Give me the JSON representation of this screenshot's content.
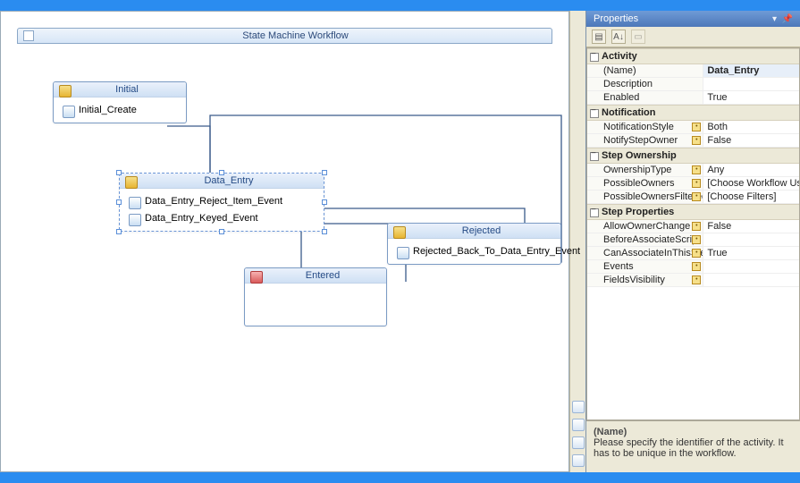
{
  "workflow": {
    "title": "State Machine Workflow",
    "nodes": {
      "initial": {
        "label": "Initial",
        "events": [
          "Initial_Create"
        ]
      },
      "data_entry": {
        "label": "Data_Entry",
        "events": [
          "Data_Entry_Reject_Item_Event",
          "Data_Entry_Keyed_Event"
        ]
      },
      "rejected": {
        "label": "Rejected",
        "events": [
          "Rejected_Back_To_Data_Entry_Event"
        ]
      },
      "entered": {
        "label": "Entered",
        "events": []
      }
    }
  },
  "properties_panel": {
    "title": "Properties",
    "categories": [
      {
        "name": "Activity",
        "props": [
          {
            "k": "(Name)",
            "v": "Data_Entry",
            "selected": true
          },
          {
            "k": "Description",
            "v": ""
          },
          {
            "k": "Enabled",
            "v": "True"
          }
        ]
      },
      {
        "name": "Notification",
        "props": [
          {
            "k": "NotificationStyle",
            "v": "Both",
            "enum": true
          },
          {
            "k": "NotifyStepOwner",
            "v": "False",
            "enum": true
          }
        ]
      },
      {
        "name": "Step Ownership",
        "props": [
          {
            "k": "OwnershipType",
            "v": "Any",
            "enum": true
          },
          {
            "k": "PossibleOwners",
            "v": "[Choose Workflow Users]",
            "enum": true
          },
          {
            "k": "PossibleOwnersFilteredBy",
            "v": "[Choose Filters]",
            "enum": true
          }
        ]
      },
      {
        "name": "Step Properties",
        "props": [
          {
            "k": "AllowOwnerChange",
            "v": "False",
            "enum": true
          },
          {
            "k": "BeforeAssociateScript",
            "v": "",
            "enum": true
          },
          {
            "k": "CanAssociateInThisStep",
            "v": "True",
            "enum": true
          },
          {
            "k": "Events",
            "v": "",
            "enum": true
          },
          {
            "k": "FieldsVisibility",
            "v": "",
            "enum": true
          }
        ]
      }
    ],
    "help": {
      "name": "(Name)",
      "desc": "Please specify the identifier of the activity. It has to be unique in the workflow."
    }
  }
}
